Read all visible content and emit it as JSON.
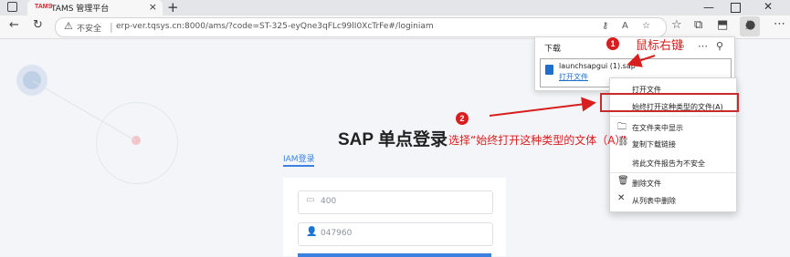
{
  "tab": {
    "logo": "TAMS",
    "title": "TAMS 管理平台",
    "close": "×"
  },
  "browser": {
    "new_tab": "+",
    "minimize": "—",
    "close": "✕",
    "back": "←",
    "reload": "↻",
    "insecure_label": "不安全",
    "url": "erp-ver.tqsys.cn:8000/ams/?code=ST-325-eyQne3qFLc99lI0XcTrFe#/loginiam",
    "menu": "⋯"
  },
  "page": {
    "title": "SAP 单点登录",
    "tab_label": "IAM登录",
    "username_value": "400",
    "password_value": "047960"
  },
  "downloads": {
    "title": "下载",
    "file_name": "launchsapgui (1).sap",
    "open_link": "打开文件"
  },
  "context_menu": {
    "items": [
      {
        "label": "打开文件",
        "icon": ""
      },
      {
        "label": "始终打开这种类型的文件(A)",
        "icon": ""
      },
      {
        "label": "在文件夹中显示",
        "icon": "folder-icon"
      },
      {
        "label": "复制下载链接",
        "icon": "link-icon"
      },
      {
        "label": "将此文件报告为不安全",
        "icon": ""
      },
      {
        "label": "删除文件",
        "icon": "trash-icon"
      },
      {
        "label": "从列表中删除",
        "icon": "close-icon"
      }
    ]
  },
  "annotations": {
    "badge1": "1",
    "text1": "鼠标右键",
    "badge2": "2",
    "text2": "选择“始终打开这种类型的文体（A）”"
  },
  "colors": {
    "annotation": "#d81e1e",
    "accent": "#3b82e0"
  }
}
